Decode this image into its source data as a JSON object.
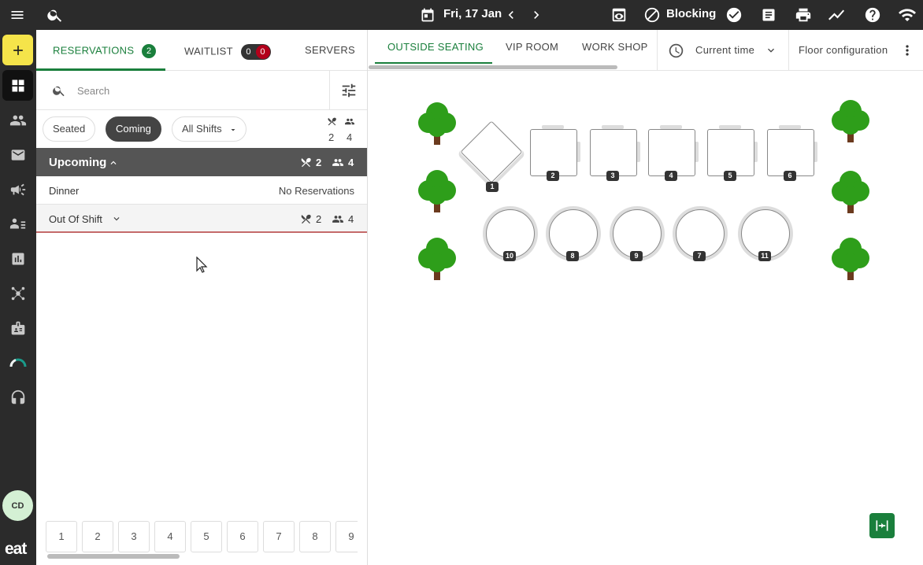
{
  "topbar": {
    "date": "Fri, 17 Jan",
    "blocking_label": "Blocking"
  },
  "user": {
    "initials": "CD"
  },
  "brand": {
    "logo_text": "eat"
  },
  "left_tabs": {
    "reservations_label": "RESERVATIONS",
    "reservations_count": "2",
    "waitlist_label": "WAITLIST",
    "waitlist_count_a": "0",
    "waitlist_count_b": "0",
    "servers_label": "SERVERS"
  },
  "search": {
    "placeholder": "Search"
  },
  "filters": {
    "seated": "Seated",
    "coming": "Coming",
    "shifts": "All Shifts",
    "covers_tables": "2",
    "covers_people": "4"
  },
  "groups": {
    "upcoming_title": "Upcoming",
    "upcoming_tables": "2",
    "upcoming_people": "4",
    "dinner_label": "Dinner",
    "dinner_status": "No Reservations",
    "out_of_shift_label": "Out Of Shift",
    "out_tables": "2",
    "out_people": "4"
  },
  "pager": {
    "pages": [
      "1",
      "2",
      "3",
      "4",
      "5",
      "6",
      "7",
      "8",
      "9"
    ]
  },
  "right_tabs": {
    "outside": "OUTSIDE SEATING",
    "vip": "VIP ROOM",
    "workshop": "WORK SHOP",
    "time": "Current time",
    "floor_config": "Floor configuration"
  },
  "tables": {
    "square": [
      "1",
      "2",
      "3",
      "4",
      "5",
      "6"
    ],
    "round": [
      "10",
      "8",
      "9",
      "7",
      "11"
    ]
  },
  "colors": {
    "accent": "#1a7f3c",
    "dark": "#2b2b2b",
    "add": "#f5e44a",
    "alert": "#b3001b"
  }
}
